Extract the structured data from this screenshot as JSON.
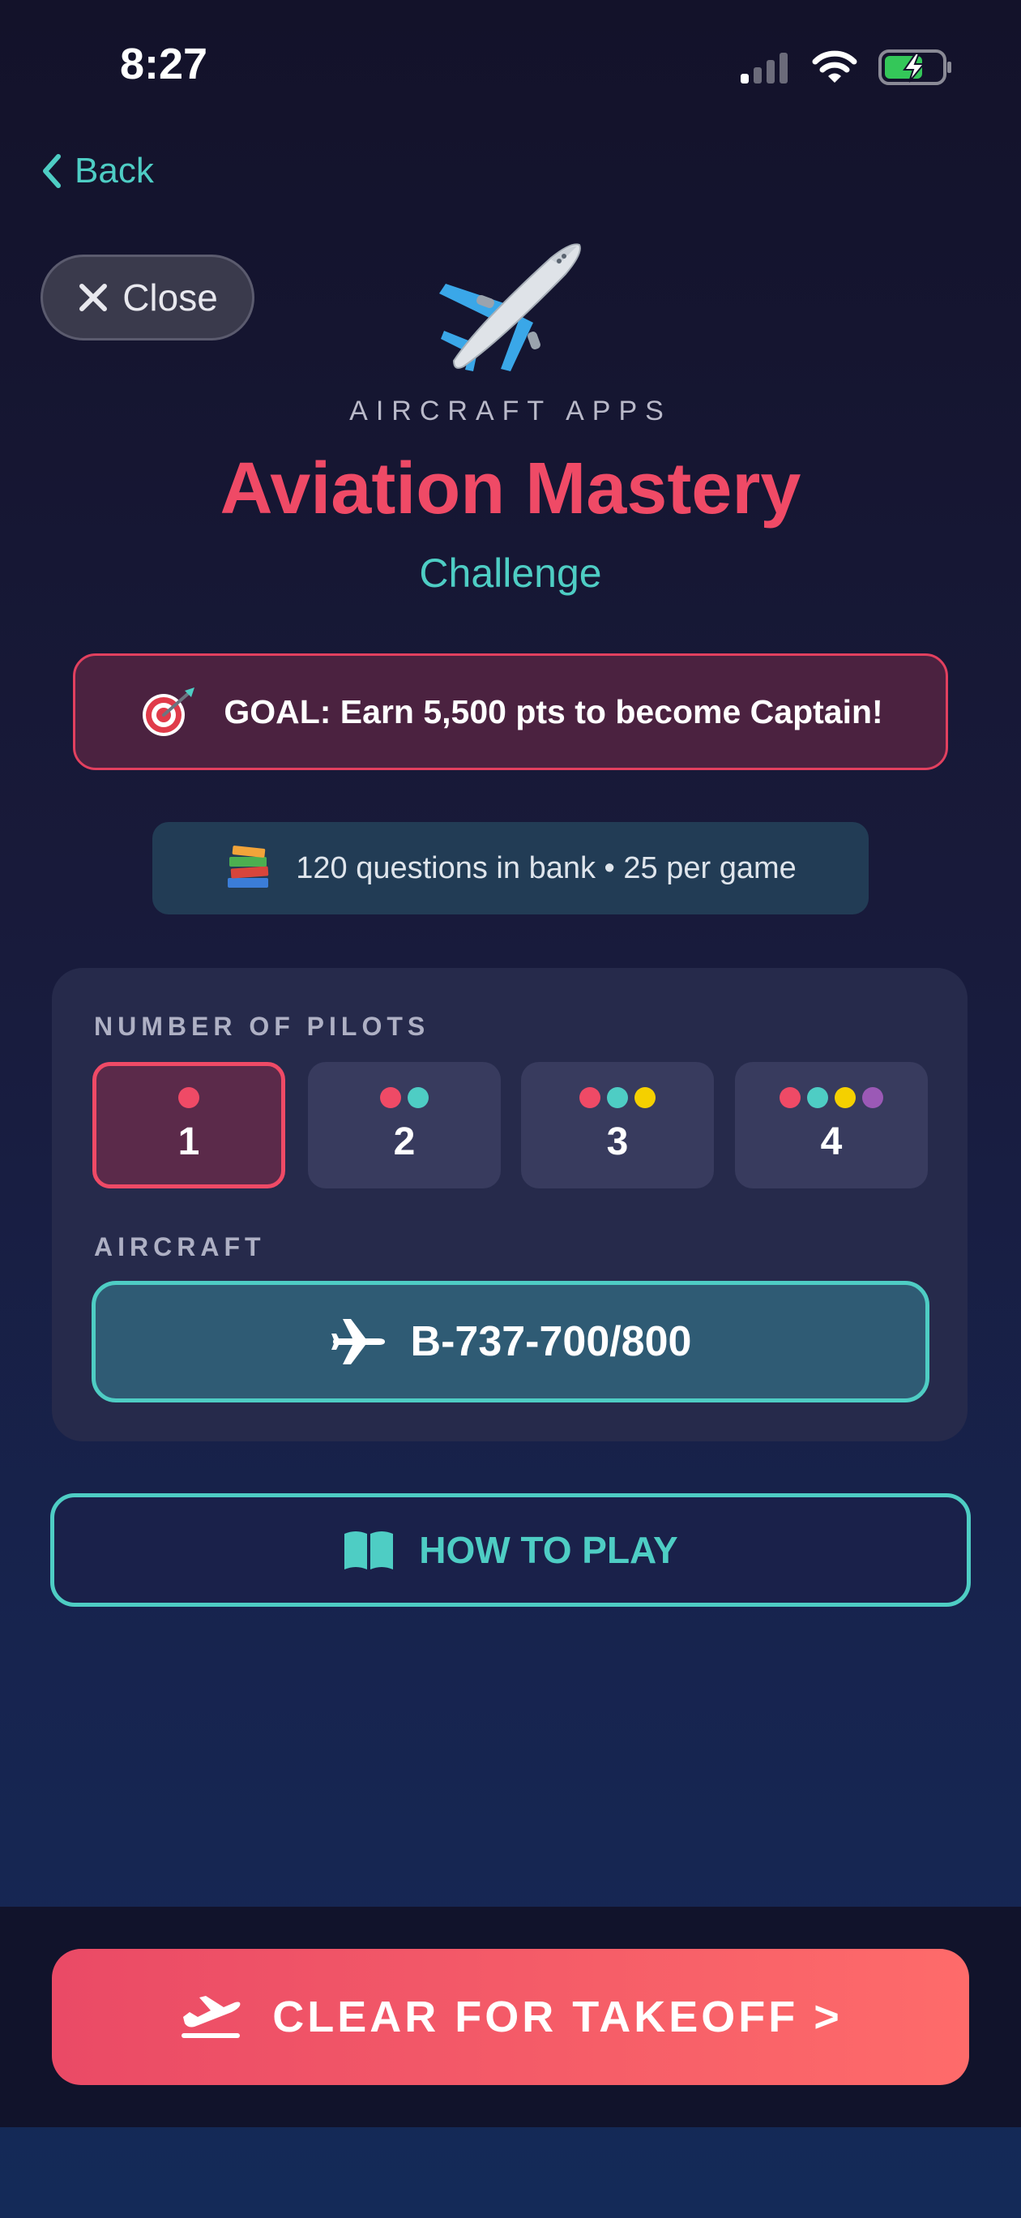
{
  "status_bar": {
    "time": "8:27"
  },
  "nav": {
    "back_label": "Back",
    "close_label": "Close"
  },
  "header": {
    "icon": "airplane-emoji",
    "brand": "AIRCRAFT APPS",
    "title": "Aviation Mastery",
    "subtitle": "Challenge"
  },
  "goal": {
    "icon": "target-icon",
    "text": "GOAL: Earn 5,500 pts to become Captain!"
  },
  "bank": {
    "icon": "books-icon",
    "text": "120 questions in bank • 25 per game"
  },
  "setup": {
    "pilots_label": "NUMBER OF PILOTS",
    "pilot_options": [
      {
        "label": "1",
        "selected": true
      },
      {
        "label": "2",
        "selected": false
      },
      {
        "label": "3",
        "selected": false
      },
      {
        "label": "4",
        "selected": false
      }
    ],
    "aircraft_label": "AIRCRAFT",
    "aircraft_value": "B-737-700/800"
  },
  "how_to_play": {
    "label": "HOW TO PLAY",
    "icon": "open-book-icon"
  },
  "cta": {
    "label": "CLEAR FOR TAKEOFF >",
    "icon": "plane-departure-icon"
  },
  "colors": {
    "accent_red": "#ef4a66",
    "accent_teal": "#4ecdc4",
    "pilot_dot_1": "#ef4a66",
    "pilot_dot_2": "#4ecdc4",
    "pilot_dot_3": "#f5d000",
    "pilot_dot_4": "#9b59b6"
  }
}
